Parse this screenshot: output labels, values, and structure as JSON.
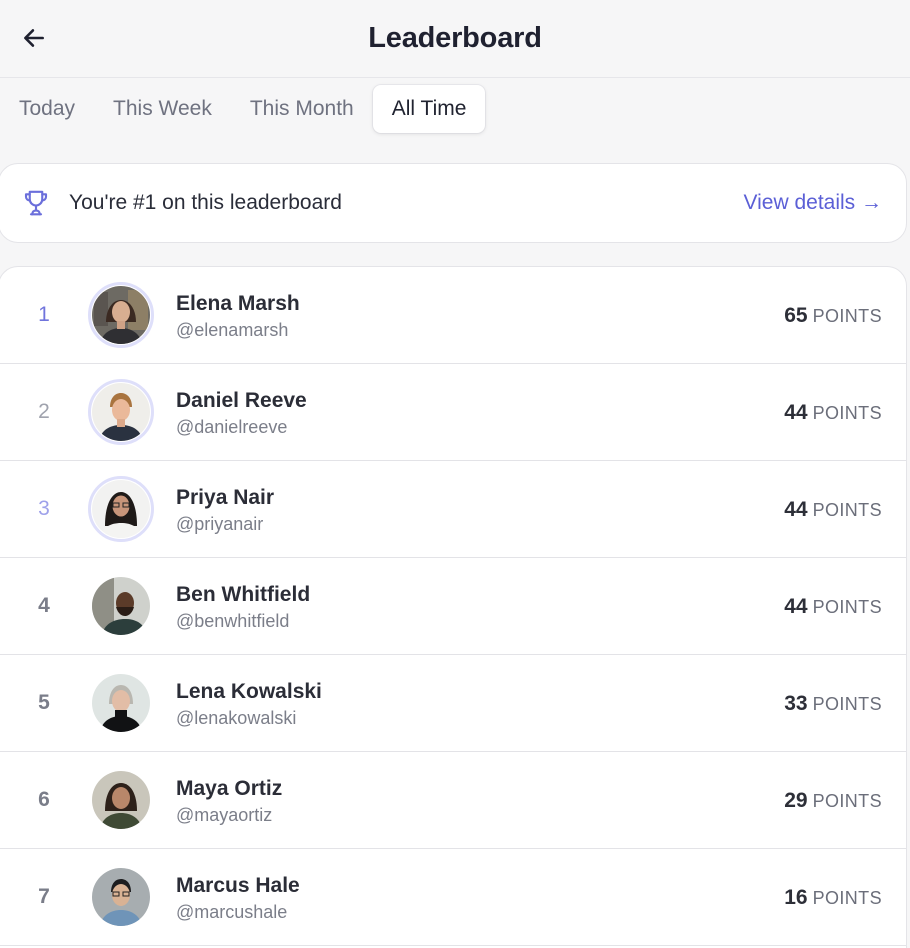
{
  "header": {
    "title": "Leaderboard"
  },
  "tabs": [
    {
      "label": "Today",
      "active": false
    },
    {
      "label": "This Week",
      "active": false
    },
    {
      "label": "This Month",
      "active": false
    },
    {
      "label": "All Time",
      "active": true
    }
  ],
  "banner": {
    "icon": "trophy-icon",
    "text": "You're #1 on this leaderboard",
    "link": "View details →"
  },
  "leaderboard": [
    {
      "rank": "1",
      "name": "Elena Marsh",
      "handle": "@elenamarsh",
      "points": "65",
      "unit": "POINTS"
    },
    {
      "rank": "2",
      "name": "Daniel Reeve",
      "handle": "@danielreeve",
      "points": "44",
      "unit": "POINTS"
    },
    {
      "rank": "3",
      "name": "Priya Nair",
      "handle": "@priyanair",
      "points": "44",
      "unit": "POINTS"
    },
    {
      "rank": "4",
      "name": "Ben Whitfield",
      "handle": "@benwhitfield",
      "points": "44",
      "unit": "POINTS"
    },
    {
      "rank": "5",
      "name": "Lena Kowalski",
      "handle": "@lenakowalski",
      "points": "33",
      "unit": "POINTS"
    },
    {
      "rank": "6",
      "name": "Maya Ortiz",
      "handle": "@mayaortiz",
      "points": "29",
      "unit": "POINTS"
    },
    {
      "rank": "7",
      "name": "Marcus Hale",
      "handle": "@marcushale",
      "points": "16",
      "unit": "POINTS"
    }
  ],
  "colors": {
    "accent": "#5b5fd6",
    "rank_highlight": "#7074dc",
    "background": "#f6f6f7"
  }
}
